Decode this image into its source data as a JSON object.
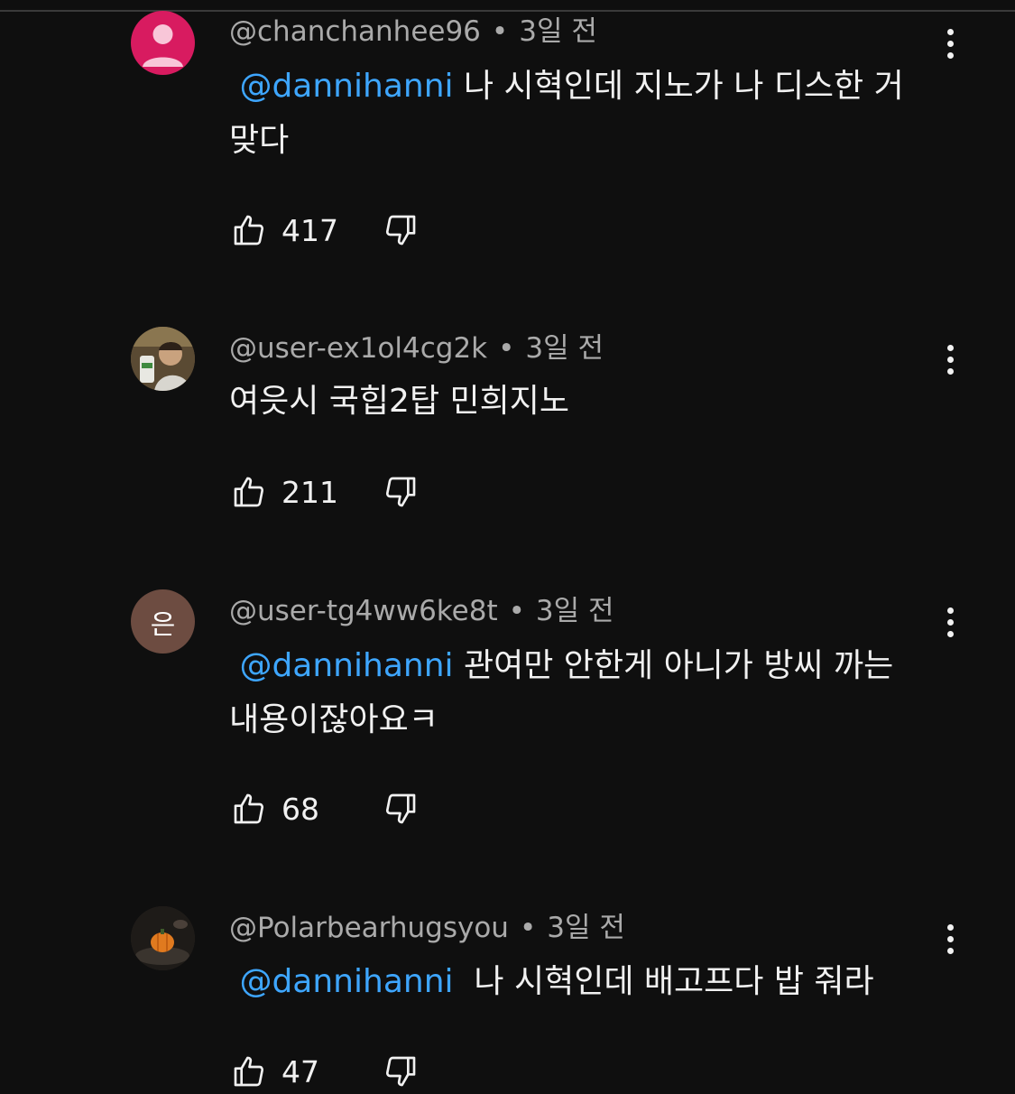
{
  "colors": {
    "background": "#0f0f0f",
    "text": "#f1f1f1",
    "meta": "#aaaaaa",
    "mention": "#3ea6ff"
  },
  "icons": {
    "like": "thumbs-up-outline",
    "dislike": "thumbs-down-outline",
    "more": "vertical-ellipsis"
  },
  "comments": [
    {
      "author": "@chanchanhee96",
      "time": "3일 전",
      "mention": "@dannihanni",
      "text": " 나 시혁인데 지노가 나 디스한 거 맞다",
      "likes": "417",
      "avatar": {
        "type": "default",
        "color": "#d81b60"
      }
    },
    {
      "author": "@user-ex1ol4cg2k",
      "time": "3일 전",
      "mention": "",
      "text": "여읏시 국힙2탑 민희지노",
      "likes": "211",
      "avatar": {
        "type": "photo",
        "color": "#6b5a3c"
      }
    },
    {
      "author": "@user-tg4ww6ke8t",
      "time": "3일 전",
      "mention": "@dannihanni",
      "text": " 관여만 안한게 아니가 방씨 까는 내용이잖아요ㅋ",
      "likes": "68",
      "avatar": {
        "type": "initial",
        "initial": "은",
        "color": "#6d4c41"
      }
    },
    {
      "author": "@Polarbearhugsyou",
      "time": "3일 전",
      "mention": "@dannihanni",
      "text": "  나 시혁인데 배고프다 밥 줘라",
      "likes": "47",
      "avatar": {
        "type": "photo",
        "color": "#2a2622"
      }
    }
  ]
}
